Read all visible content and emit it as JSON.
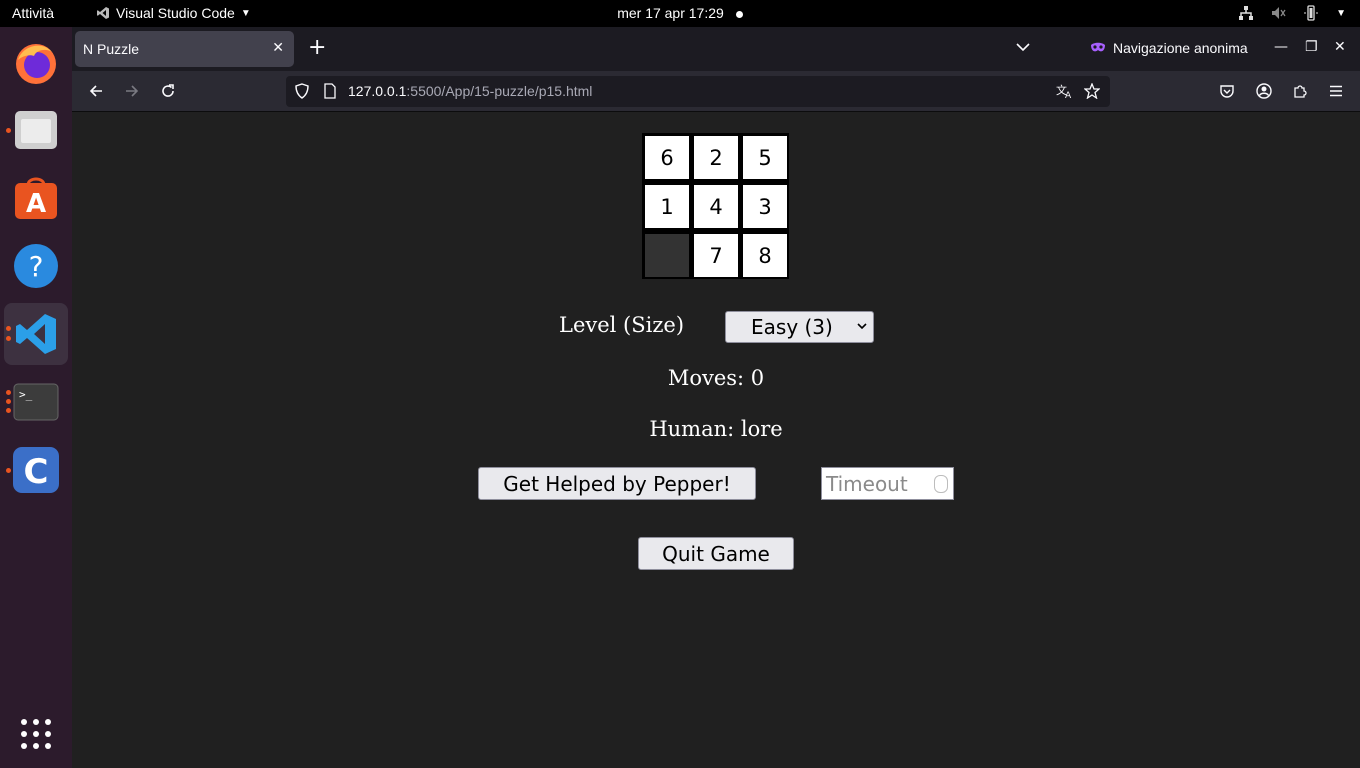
{
  "topbar": {
    "activities": "Attività",
    "app_name": "Visual Studio Code",
    "clock": "mer 17 apr  17:29"
  },
  "dock": {
    "items": [
      "firefox-icon",
      "files-icon",
      "app-center-icon",
      "help-icon",
      "vscode-icon",
      "terminal-icon",
      "codeblocks-icon",
      "show-apps-icon"
    ]
  },
  "browser": {
    "tab_title": "N Puzzle",
    "private_label": "Navigazione anonima",
    "url_host": "127.0.0.1",
    "url_rest": ":5500/App/15-puzzle/p15.html"
  },
  "puzzle": {
    "size": 3,
    "tiles": [
      "6",
      "2",
      "5",
      "1",
      "4",
      "3",
      "",
      "7",
      "8"
    ]
  },
  "controls": {
    "level_label": "Level (Size)",
    "level_value": "Easy (3)",
    "moves_text": "Moves: 0",
    "human_text": "Human: lore",
    "help_button": "Get Helped by Pepper!",
    "timeout_placeholder": "Timeout",
    "quit_button": "Quit Game"
  },
  "colors": {
    "page_bg": "#202020",
    "tile_bg": "#ffffff",
    "empty_tile_bg": "#333333",
    "accent_ubuntu": "#e95420"
  }
}
